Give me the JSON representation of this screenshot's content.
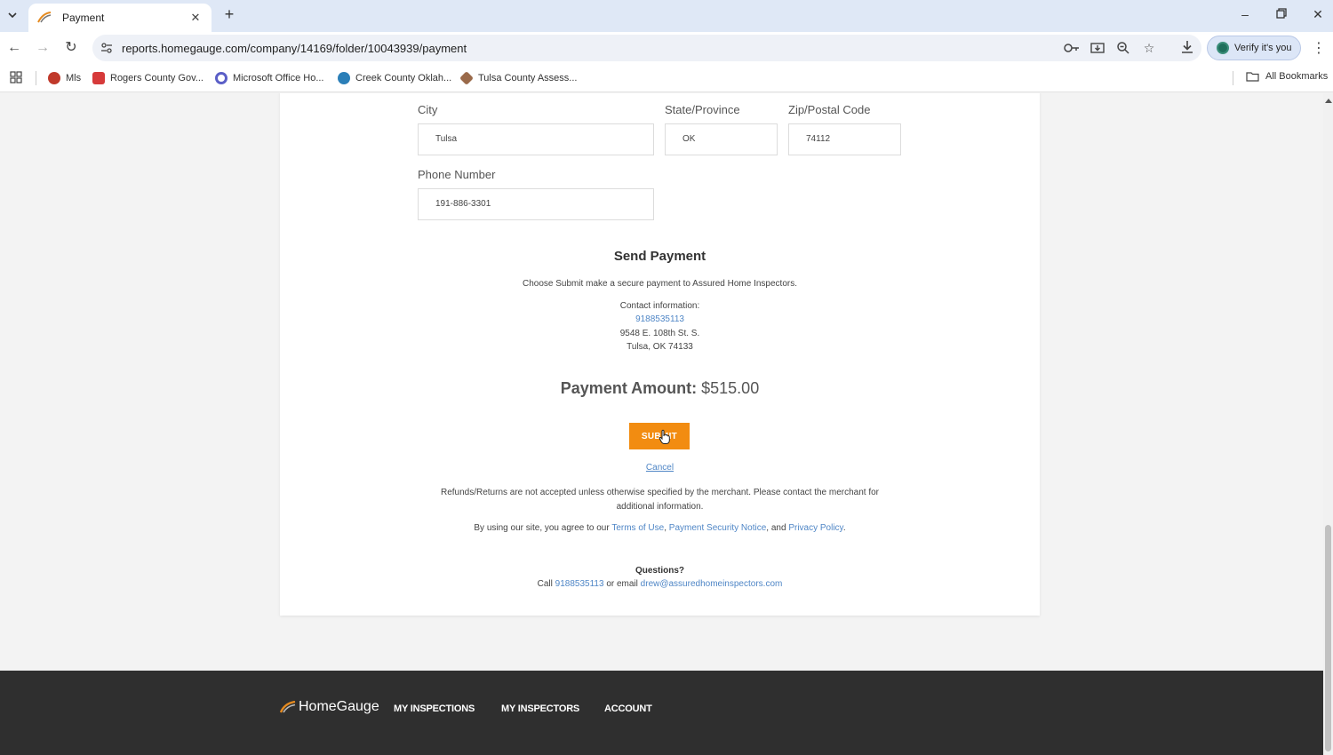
{
  "browser": {
    "tab_title": "Payment",
    "url": "reports.homegauge.com/company/14169/folder/10043939/payment",
    "verify_label": "Verify it's you",
    "bookmarks": [
      "Mls",
      "Rogers County Gov...",
      "Microsoft Office Ho...",
      "Creek County Oklah...",
      "Tulsa County Assess..."
    ],
    "all_bookmarks": "All Bookmarks"
  },
  "form": {
    "city_label": "City",
    "city_value": "Tulsa",
    "state_label": "State/Province",
    "state_value": "OK",
    "zip_label": "Zip/Postal Code",
    "zip_value": "74112",
    "phone_label": "Phone Number",
    "phone_value": "191-886-3301"
  },
  "payment": {
    "title": "Send Payment",
    "description": "Choose Submit make a secure payment to Assured Home Inspectors.",
    "contact_label": "Contact information:",
    "contact_phone": "9188535113",
    "contact_address1": "9548 E. 108th St. S.",
    "contact_address2": "Tulsa, OK 74133",
    "amount_label": "Payment Amount:",
    "amount_value": "$515.00",
    "submit_label": "SUBMIT",
    "cancel_label": "Cancel",
    "refund_text": "Refunds/Returns are not accepted unless otherwise specified by the merchant. Please contact the merchant for additional information.",
    "terms_prefix": "By using our site, you agree to our",
    "terms_link": "Terms of Use",
    "terms_sep": ",",
    "security_link": "Payment Security Notice",
    "terms_and": ", and",
    "privacy_link": "Privacy Policy",
    "terms_end": ".",
    "questions_title": "Questions?",
    "call_prefix": "Call",
    "call_number": "9188535113",
    "email_mid": "or email",
    "email": "drew@assuredhomeinspectors.com"
  },
  "footer": {
    "logo_text": "HomeGauge",
    "nav": [
      "MY INSPECTIONS",
      "MY INSPECTORS",
      "ACCOUNT"
    ]
  },
  "colors": {
    "accent": "#f28c11",
    "link": "#4f86c6",
    "footer_bg": "#2f2f2f"
  }
}
